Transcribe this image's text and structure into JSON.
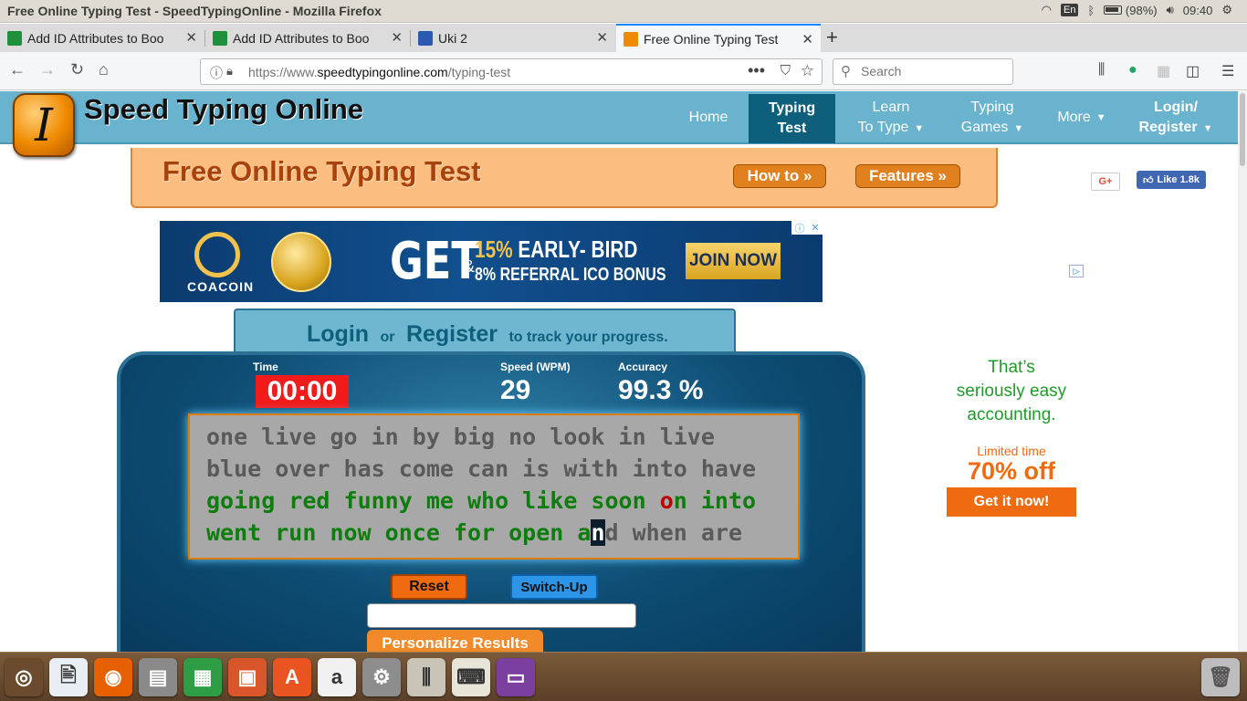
{
  "os_panel": {
    "window_title": "Free Online Typing Test - SpeedTypingOnline - Mozilla Firefox",
    "keyboard_layout": "En",
    "battery": "(98%)",
    "clock": "09:40"
  },
  "tabs": [
    {
      "title": "Add ID Attributes to Boo",
      "icon_color": "#1e8f3a"
    },
    {
      "title": "Add ID Attributes to Boo",
      "icon_color": "#1e8f3a"
    },
    {
      "title": "Uki 2",
      "icon_color": "#2a5bb0"
    },
    {
      "title": "Free Online Typing Test",
      "icon_color": "#f08a00"
    }
  ],
  "address_bar": {
    "url_prefix": "https://www.",
    "url_domain": "speedtypingonline.com",
    "url_path": "/typing-test",
    "search_placeholder": "Search"
  },
  "site": {
    "logo_letter": "I",
    "name": "Speed Typing Online",
    "menu": [
      {
        "line1": "Home",
        "line2": "",
        "caret": false
      },
      {
        "line1": "Typing",
        "line2": "Test",
        "caret": false,
        "active": true
      },
      {
        "line1": "Learn",
        "line2": "To Type",
        "caret": true
      },
      {
        "line1": "Typing",
        "line2": "Games",
        "caret": true
      },
      {
        "line1": "More",
        "line2": "",
        "caret": true
      },
      {
        "line1": "Login/",
        "line2": "Register",
        "caret": true
      }
    ],
    "banner_title": "Free Online Typing Test",
    "howto_button": "How to »",
    "features_button": "Features »",
    "gplus": "G+",
    "fb_like": "Like 1.8k"
  },
  "top_ad": {
    "brand": "COACOIN",
    "get": "GET",
    "amp": "&",
    "line1_percent": "15%",
    "line1_text": " EARLY- BIRD",
    "line2": "8% REFERRAL ICO BONUS",
    "cta": "JOIN NOW"
  },
  "login_prompt": {
    "login": "Login",
    "or": "or",
    "register": "Register",
    "tail": "to track your progress."
  },
  "test": {
    "time_label": "Time",
    "time_value": "00:00",
    "speed_label": "Speed (WPM)",
    "speed_value": "29",
    "accuracy_label": "Accuracy",
    "accuracy_value": "99.3 %",
    "lines": [
      [
        {
          "t": "one live go in by big no look in live",
          "s": "pending"
        }
      ],
      [
        {
          "t": "blue over has come can is with into have",
          "s": "pending"
        }
      ],
      [
        {
          "t": "going red funny me who like soon ",
          "s": "ok"
        },
        {
          "t": "o",
          "s": "bad"
        },
        {
          "t": "n into",
          "s": "ok"
        }
      ],
      [
        {
          "t": "went run now once for open a",
          "s": "ok"
        },
        {
          "t": "n",
          "s": "cur"
        },
        {
          "t": "d when are",
          "s": "pending"
        }
      ]
    ],
    "reset_button": "Reset",
    "switchup_button": "Switch-Up",
    "input_value": "",
    "personalize_button": "Personalize Results"
  },
  "side_ad": {
    "slogan_1": "That’s",
    "slogan_2": "seriously easy",
    "slogan_3": "accounting.",
    "limited": "Limited time",
    "discount": "70% off",
    "cta": "Get it now!"
  },
  "dock": [
    {
      "name": "ubuntu-dash",
      "color": "#6b4a2e",
      "glyph": "◎"
    },
    {
      "name": "document-viewer",
      "color": "#e9eef5",
      "glyph": "🖹"
    },
    {
      "name": "firefox",
      "color": "#e66000",
      "glyph": "◉"
    },
    {
      "name": "files",
      "color": "#8a8a8a",
      "glyph": "▤"
    },
    {
      "name": "spreadsheet",
      "color": "#2f9d45",
      "glyph": "▦"
    },
    {
      "name": "presentation",
      "color": "#d9562b",
      "glyph": "▣"
    },
    {
      "name": "software-center",
      "color": "#e95420",
      "glyph": "A"
    },
    {
      "name": "amazon",
      "color": "#f1f1f1",
      "glyph": "a"
    },
    {
      "name": "settings",
      "color": "#8d8d8d",
      "glyph": "⚙"
    },
    {
      "name": "system-tools",
      "color": "#c9c3b8",
      "glyph": "⫼"
    },
    {
      "name": "keyboard",
      "color": "#e8e4d8",
      "glyph": "⌨"
    },
    {
      "name": "workspaces",
      "color": "#7b3fa0",
      "glyph": "▭"
    }
  ]
}
